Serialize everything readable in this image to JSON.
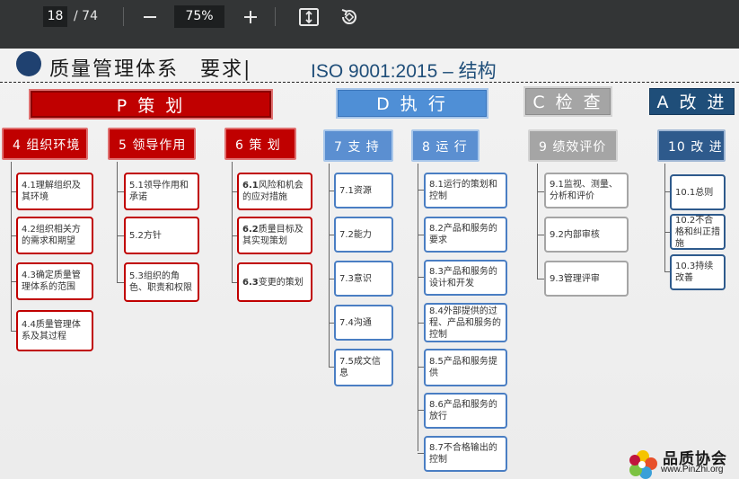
{
  "viewer": {
    "current_page": "18",
    "total_pages": "/ 74",
    "zoom_out_icon": "minus-icon",
    "zoom_level": "75%",
    "zoom_in_icon": "plus-icon",
    "fit_icon": "fit-page-icon",
    "rotate_icon": "rotate-icon"
  },
  "slide": {
    "title_cn": "质量管理体系　要求|",
    "title_en": "ISO 9001:2015 – 结构",
    "categories": {
      "p": "P 策 划",
      "d": "D 执 行",
      "c": "C 检 查",
      "a": "A 改 进"
    },
    "col4": {
      "header": "4  组织环境",
      "items": [
        "4.1理解组织及其环境",
        "4.2组织相关方的需求和期望",
        "4.3确定质量管理体系的范围",
        "4.4质量管理体系及其过程"
      ]
    },
    "col5": {
      "header": "5  领导作用",
      "items": [
        "5.1领导作用和承诺",
        "5.2方针",
        "5.3组织的角色、职责和权限"
      ]
    },
    "col6": {
      "header": "6  策    划",
      "items": [
        {
          "num": "6.1",
          "text": "风险和机会的应对措施"
        },
        {
          "num": "6.2",
          "text": "质量目标及其实现策划"
        },
        {
          "num": "6.3",
          "text": "变更的策划"
        }
      ]
    },
    "col7": {
      "header": "7  支  持",
      "items": [
        "7.1资源",
        "7.2能力",
        "7.3意识",
        "7.4沟通",
        "7.5成文信息"
      ]
    },
    "col8": {
      "header": "8  运  行",
      "items": [
        "8.1运行的策划和控制",
        "8.2产品和服务的要求",
        "8.3产品和服务的设计和开发",
        "8.4外部提供的过程、产品和服务的控制",
        "8.5产品和服务提供",
        "8.6产品和服务的放行",
        "8.7不合格输出的控制"
      ]
    },
    "col9": {
      "header": "9  绩效评价",
      "items": [
        "9.1监视、测量、分析和评价",
        "9.2内部审核",
        "9.3管理评审"
      ]
    },
    "col10": {
      "header": "10 改    进",
      "items": [
        "10.1总则",
        "10.2不合格和纠正措施",
        "10.3持续改善"
      ]
    },
    "logo": {
      "name": "品质协会",
      "url": "www.PinZhi.org"
    }
  },
  "colors": {
    "plan_red": "#c00000",
    "do_blue": "#4f8fd6",
    "check_gray": "#a5a5a5",
    "act_navy": "#1f4e79",
    "toolbar_bg": "#333536"
  }
}
